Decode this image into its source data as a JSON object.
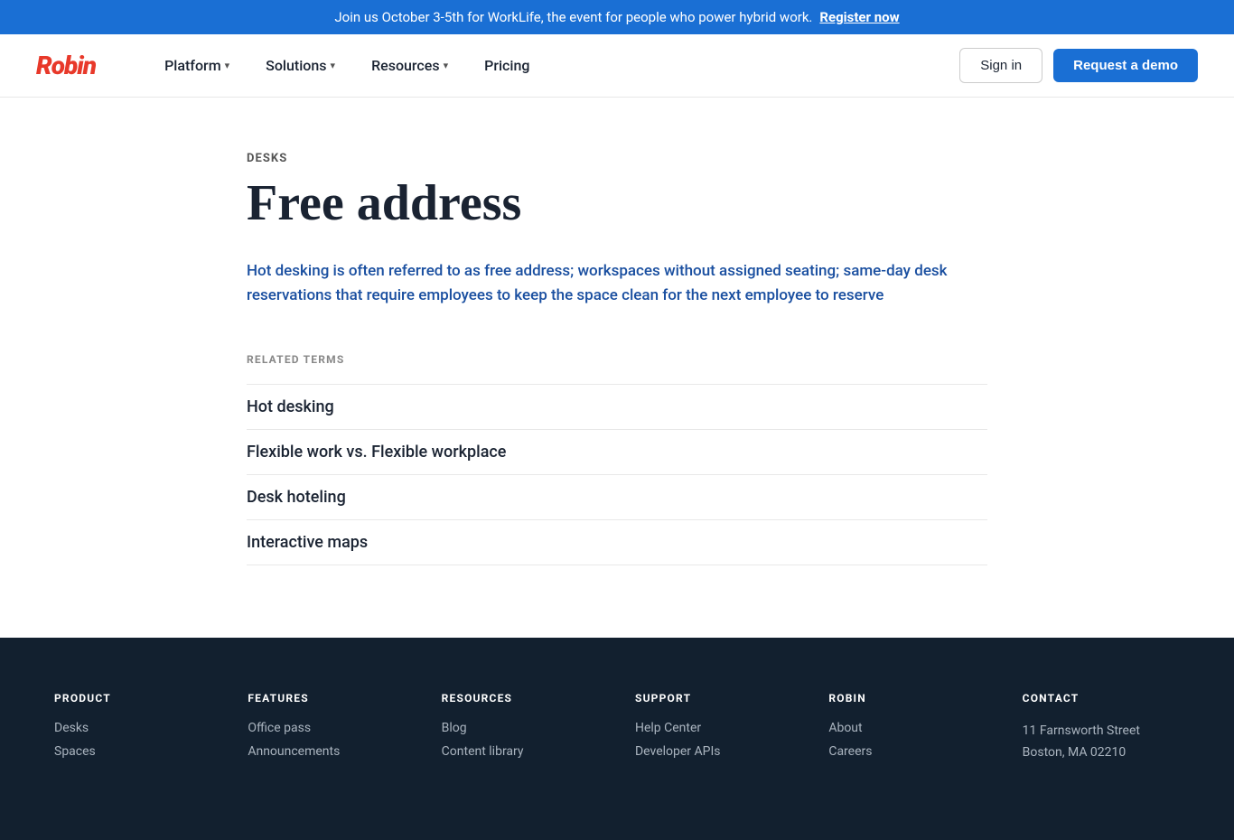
{
  "banner": {
    "text": "Join us October 3-5th for WorkLife, the event for people who power hybrid work.",
    "cta": "Register now"
  },
  "nav": {
    "logo": "Robin",
    "links": [
      {
        "label": "Platform",
        "hasDropdown": true
      },
      {
        "label": "Solutions",
        "hasDropdown": true
      },
      {
        "label": "Resources",
        "hasDropdown": true
      },
      {
        "label": "Pricing",
        "hasDropdown": false
      }
    ],
    "signin": "Sign in",
    "demo": "Request a demo"
  },
  "main": {
    "category": "DESKS",
    "title": "Free address",
    "description": "Hot desking is often referred to as free address; workspaces without assigned seating; same-day desk reservations that require employees to keep the space clean for the next employee to reserve",
    "related_terms_label": "RELATED TERMS",
    "related_terms": [
      "Hot desking",
      "Flexible work vs. Flexible workplace",
      "Desk hoteling",
      "Interactive maps"
    ]
  },
  "footer": {
    "columns": [
      {
        "title": "PRODUCT",
        "links": [
          "Desks",
          "Spaces"
        ]
      },
      {
        "title": "FEATURES",
        "links": [
          "Office pass",
          "Announcements"
        ]
      },
      {
        "title": "RESOURCES",
        "links": [
          "Blog",
          "Content library"
        ]
      },
      {
        "title": "SUPPORT",
        "links": [
          "Help Center",
          "Developer APIs"
        ]
      },
      {
        "title": "ROBIN",
        "links": [
          "About",
          "Careers"
        ]
      },
      {
        "title": "CONTACT",
        "address_line1": "11 Farnsworth Street",
        "address_line2": "Boston, MA 02210"
      }
    ]
  }
}
